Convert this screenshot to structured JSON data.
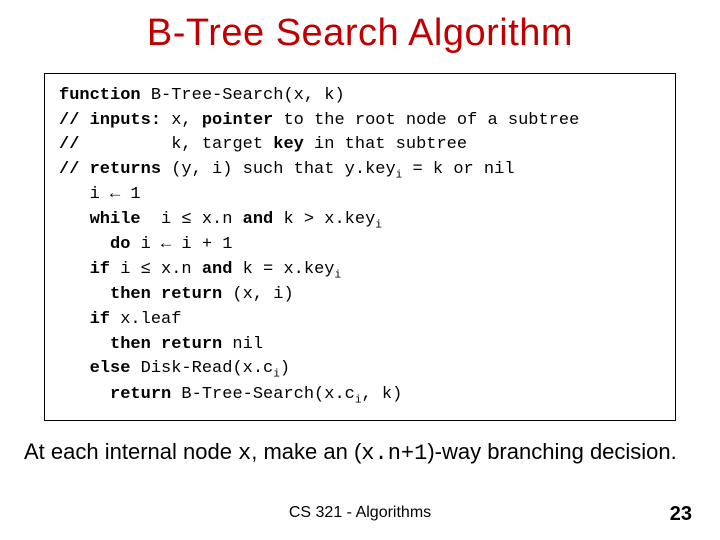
{
  "title": "B-Tree Search Algorithm",
  "code": {
    "l1a": "function",
    "l1b": " B-Tree-Search(x, k)",
    "l2a": "// inputs:",
    "l2b": " x, ",
    "l2c": "pointer",
    "l2d": " to the root node of a subtree",
    "l3a": "//        ",
    "l3b": " k, target ",
    "l3c": "key",
    "l3d": " in that subtree",
    "l4a": "// returns",
    "l4b": " (y, i) such that y.key",
    "l4c": "i",
    "l4d": " = k or nil",
    "l5": "   i ← 1",
    "l6a": "   ",
    "l6b": "while",
    "l6c": "  i ≤ x.n ",
    "l6d": "and",
    "l6e": " k > x.key",
    "l6f": "i",
    "l7a": "     ",
    "l7b": "do",
    "l7c": " i ← i + 1",
    "l8a": "   ",
    "l8b": "if",
    "l8c": " i ≤ x.n ",
    "l8d": "and",
    "l8e": " k = x.key",
    "l8f": "i",
    "l9a": "     ",
    "l9b": "then return",
    "l9c": " (x, i)",
    "l10a": "   ",
    "l10b": "if",
    "l10c": " x.leaf",
    "l11a": "     ",
    "l11b": "then return",
    "l11c": " nil",
    "l12a": "   ",
    "l12b": "else",
    "l12c": " Disk-Read(x.c",
    "l12d": "i",
    "l12e": ")",
    "l13a": "     ",
    "l13b": "return",
    "l13c": " B-Tree-Search(x.c",
    "l13d": "i",
    "l13e": ", k)"
  },
  "caption": {
    "a": "At each internal node ",
    "b": "x",
    "c": ", make an (",
    "d": "x.n+1",
    "e": ")-way branching decision."
  },
  "footer": "CS 321 - Algorithms",
  "pagenum": "23"
}
